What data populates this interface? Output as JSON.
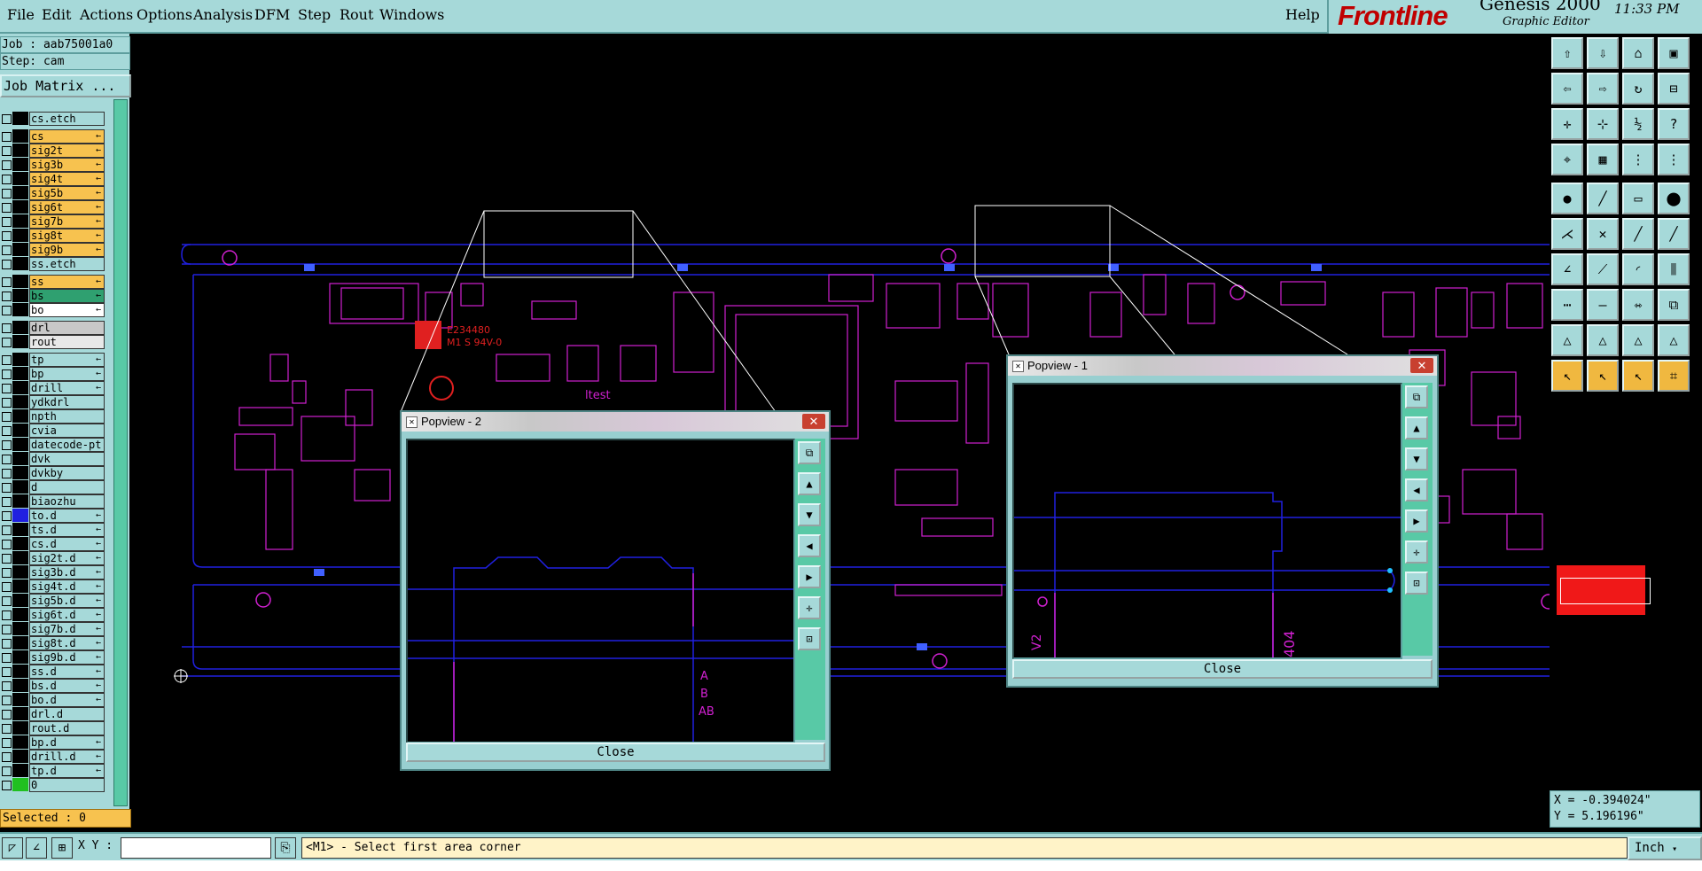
{
  "menu": [
    "File",
    "Edit",
    "Actions",
    "Options",
    "Analysis",
    "DFM",
    "Step",
    "Rout",
    "Windows"
  ],
  "help": "Help",
  "brand": {
    "logo": "Frontline",
    "product": "Genesis 2000",
    "subtitle": "Graphic Editor",
    "clock": "11:33 PM"
  },
  "job": {
    "job_label": "Job : aab75001a0",
    "step_label": "Step: cam",
    "matrix_button": "Job Matrix ..."
  },
  "layers": [
    {
      "name": "cs.etch",
      "bg": "#a6d9d9",
      "sw": "#000000",
      "arrow": ""
    },
    {
      "name": "cs",
      "bg": "#f7c24f",
      "sw": "#000000",
      "arrow": "←"
    },
    {
      "name": "sig2t",
      "bg": "#f7c24f",
      "sw": "#000000",
      "arrow": "←"
    },
    {
      "name": "sig3b",
      "bg": "#f7c24f",
      "sw": "#000000",
      "arrow": "←"
    },
    {
      "name": "sig4t",
      "bg": "#f7c24f",
      "sw": "#000000",
      "arrow": "←"
    },
    {
      "name": "sig5b",
      "bg": "#f7c24f",
      "sw": "#000000",
      "arrow": "←"
    },
    {
      "name": "sig6t",
      "bg": "#f7c24f",
      "sw": "#000000",
      "arrow": "←"
    },
    {
      "name": "sig7b",
      "bg": "#f7c24f",
      "sw": "#000000",
      "arrow": "←"
    },
    {
      "name": "sig8t",
      "bg": "#f7c24f",
      "sw": "#000000",
      "arrow": "←"
    },
    {
      "name": "sig9b",
      "bg": "#f7c24f",
      "sw": "#000000",
      "arrow": "←"
    },
    {
      "name": "ss.etch",
      "bg": "#a6d9d9",
      "sw": "#000000",
      "arrow": ""
    },
    {
      "name": "ss",
      "bg": "#f7c24f",
      "sw": "#000000",
      "arrow": "←"
    },
    {
      "name": "bs",
      "bg": "#2fa070",
      "sw": "#000000",
      "arrow": "←"
    },
    {
      "name": "bo",
      "bg": "#ffffff",
      "sw": "#000000",
      "arrow": "←"
    },
    {
      "name": "drl",
      "bg": "#c8c8c8",
      "sw": "#000000",
      "arrow": ""
    },
    {
      "name": "rout",
      "bg": "#e8e8e8",
      "sw": "#000000",
      "arrow": ""
    },
    {
      "name": "tp",
      "bg": "#a6d9d9",
      "sw": "#000000",
      "arrow": "←"
    },
    {
      "name": "bp",
      "bg": "#a6d9d9",
      "sw": "#000000",
      "arrow": "←"
    },
    {
      "name": "drill",
      "bg": "#a6d9d9",
      "sw": "#000000",
      "arrow": "←"
    },
    {
      "name": "ydkdrl",
      "bg": "#a6d9d9",
      "sw": "#000000",
      "arrow": ""
    },
    {
      "name": "npth",
      "bg": "#a6d9d9",
      "sw": "#000000",
      "arrow": ""
    },
    {
      "name": "cvia",
      "bg": "#a6d9d9",
      "sw": "#000000",
      "arrow": ""
    },
    {
      "name": "datecode-pt",
      "bg": "#a6d9d9",
      "sw": "#000000",
      "arrow": ""
    },
    {
      "name": "dvk",
      "bg": "#a6d9d9",
      "sw": "#000000",
      "arrow": ""
    },
    {
      "name": "dvkby",
      "bg": "#a6d9d9",
      "sw": "#000000",
      "arrow": ""
    },
    {
      "name": "d",
      "bg": "#a6d9d9",
      "sw": "#000000",
      "arrow": ""
    },
    {
      "name": "biaozhu",
      "bg": "#a6d9d9",
      "sw": "#000000",
      "arrow": ""
    },
    {
      "name": "to.d",
      "bg": "#a6d9d9",
      "sw": "#2020e0",
      "arrow": "←"
    },
    {
      "name": "ts.d",
      "bg": "#a6d9d9",
      "sw": "#000000",
      "arrow": "←"
    },
    {
      "name": "cs.d",
      "bg": "#a6d9d9",
      "sw": "#000000",
      "arrow": "←"
    },
    {
      "name": "sig2t.d",
      "bg": "#a6d9d9",
      "sw": "#000000",
      "arrow": "←"
    },
    {
      "name": "sig3b.d",
      "bg": "#a6d9d9",
      "sw": "#000000",
      "arrow": "←"
    },
    {
      "name": "sig4t.d",
      "bg": "#a6d9d9",
      "sw": "#000000",
      "arrow": "←"
    },
    {
      "name": "sig5b.d",
      "bg": "#a6d9d9",
      "sw": "#000000",
      "arrow": "←"
    },
    {
      "name": "sig6t.d",
      "bg": "#a6d9d9",
      "sw": "#000000",
      "arrow": "←"
    },
    {
      "name": "sig7b.d",
      "bg": "#a6d9d9",
      "sw": "#000000",
      "arrow": "←"
    },
    {
      "name": "sig8t.d",
      "bg": "#a6d9d9",
      "sw": "#000000",
      "arrow": "←"
    },
    {
      "name": "sig9b.d",
      "bg": "#a6d9d9",
      "sw": "#000000",
      "arrow": "←"
    },
    {
      "name": "ss.d",
      "bg": "#a6d9d9",
      "sw": "#000000",
      "arrow": "←"
    },
    {
      "name": "bs.d",
      "bg": "#a6d9d9",
      "sw": "#000000",
      "arrow": "←"
    },
    {
      "name": "bo.d",
      "bg": "#a6d9d9",
      "sw": "#000000",
      "arrow": "←"
    },
    {
      "name": "drl.d",
      "bg": "#a6d9d9",
      "sw": "#000000",
      "arrow": ""
    },
    {
      "name": "rout.d",
      "bg": "#a6d9d9",
      "sw": "#000000",
      "arrow": ""
    },
    {
      "name": "bp.d",
      "bg": "#a6d9d9",
      "sw": "#000000",
      "arrow": "←"
    },
    {
      "name": "drill.d",
      "bg": "#a6d9d9",
      "sw": "#000000",
      "arrow": "←"
    },
    {
      "name": "tp.d",
      "bg": "#a6d9d9",
      "sw": "#000000",
      "arrow": "←"
    },
    {
      "name": "0",
      "bg": "#a6d9d9",
      "sw": "#20c020",
      "arrow": ""
    }
  ],
  "selected": "Selected : 0",
  "bottom": {
    "xy_label": "X Y :",
    "xy_value": "",
    "status": "<M1> - Select first area corner",
    "unit": "Inch"
  },
  "coords": {
    "x": "X = -0.394024\"",
    "y": "Y = 5.196196\""
  },
  "board_text": {
    "part": "E234480",
    "rev": "M1 S 94V-0",
    "itest": "ltest"
  },
  "popup2": {
    "title": "Popview - 2",
    "close": "Close",
    "labels": [
      "A",
      "B",
      "AB"
    ]
  },
  "popup1": {
    "title": "Popview - 1",
    "close": "Close",
    "labels": [
      "V2",
      "404"
    ]
  },
  "colors": {
    "panel": "#a6d9d9",
    "accent": "#f7c24f",
    "board_lines": "#2020e0",
    "components": "#d020d0",
    "marking": "#e02020"
  }
}
